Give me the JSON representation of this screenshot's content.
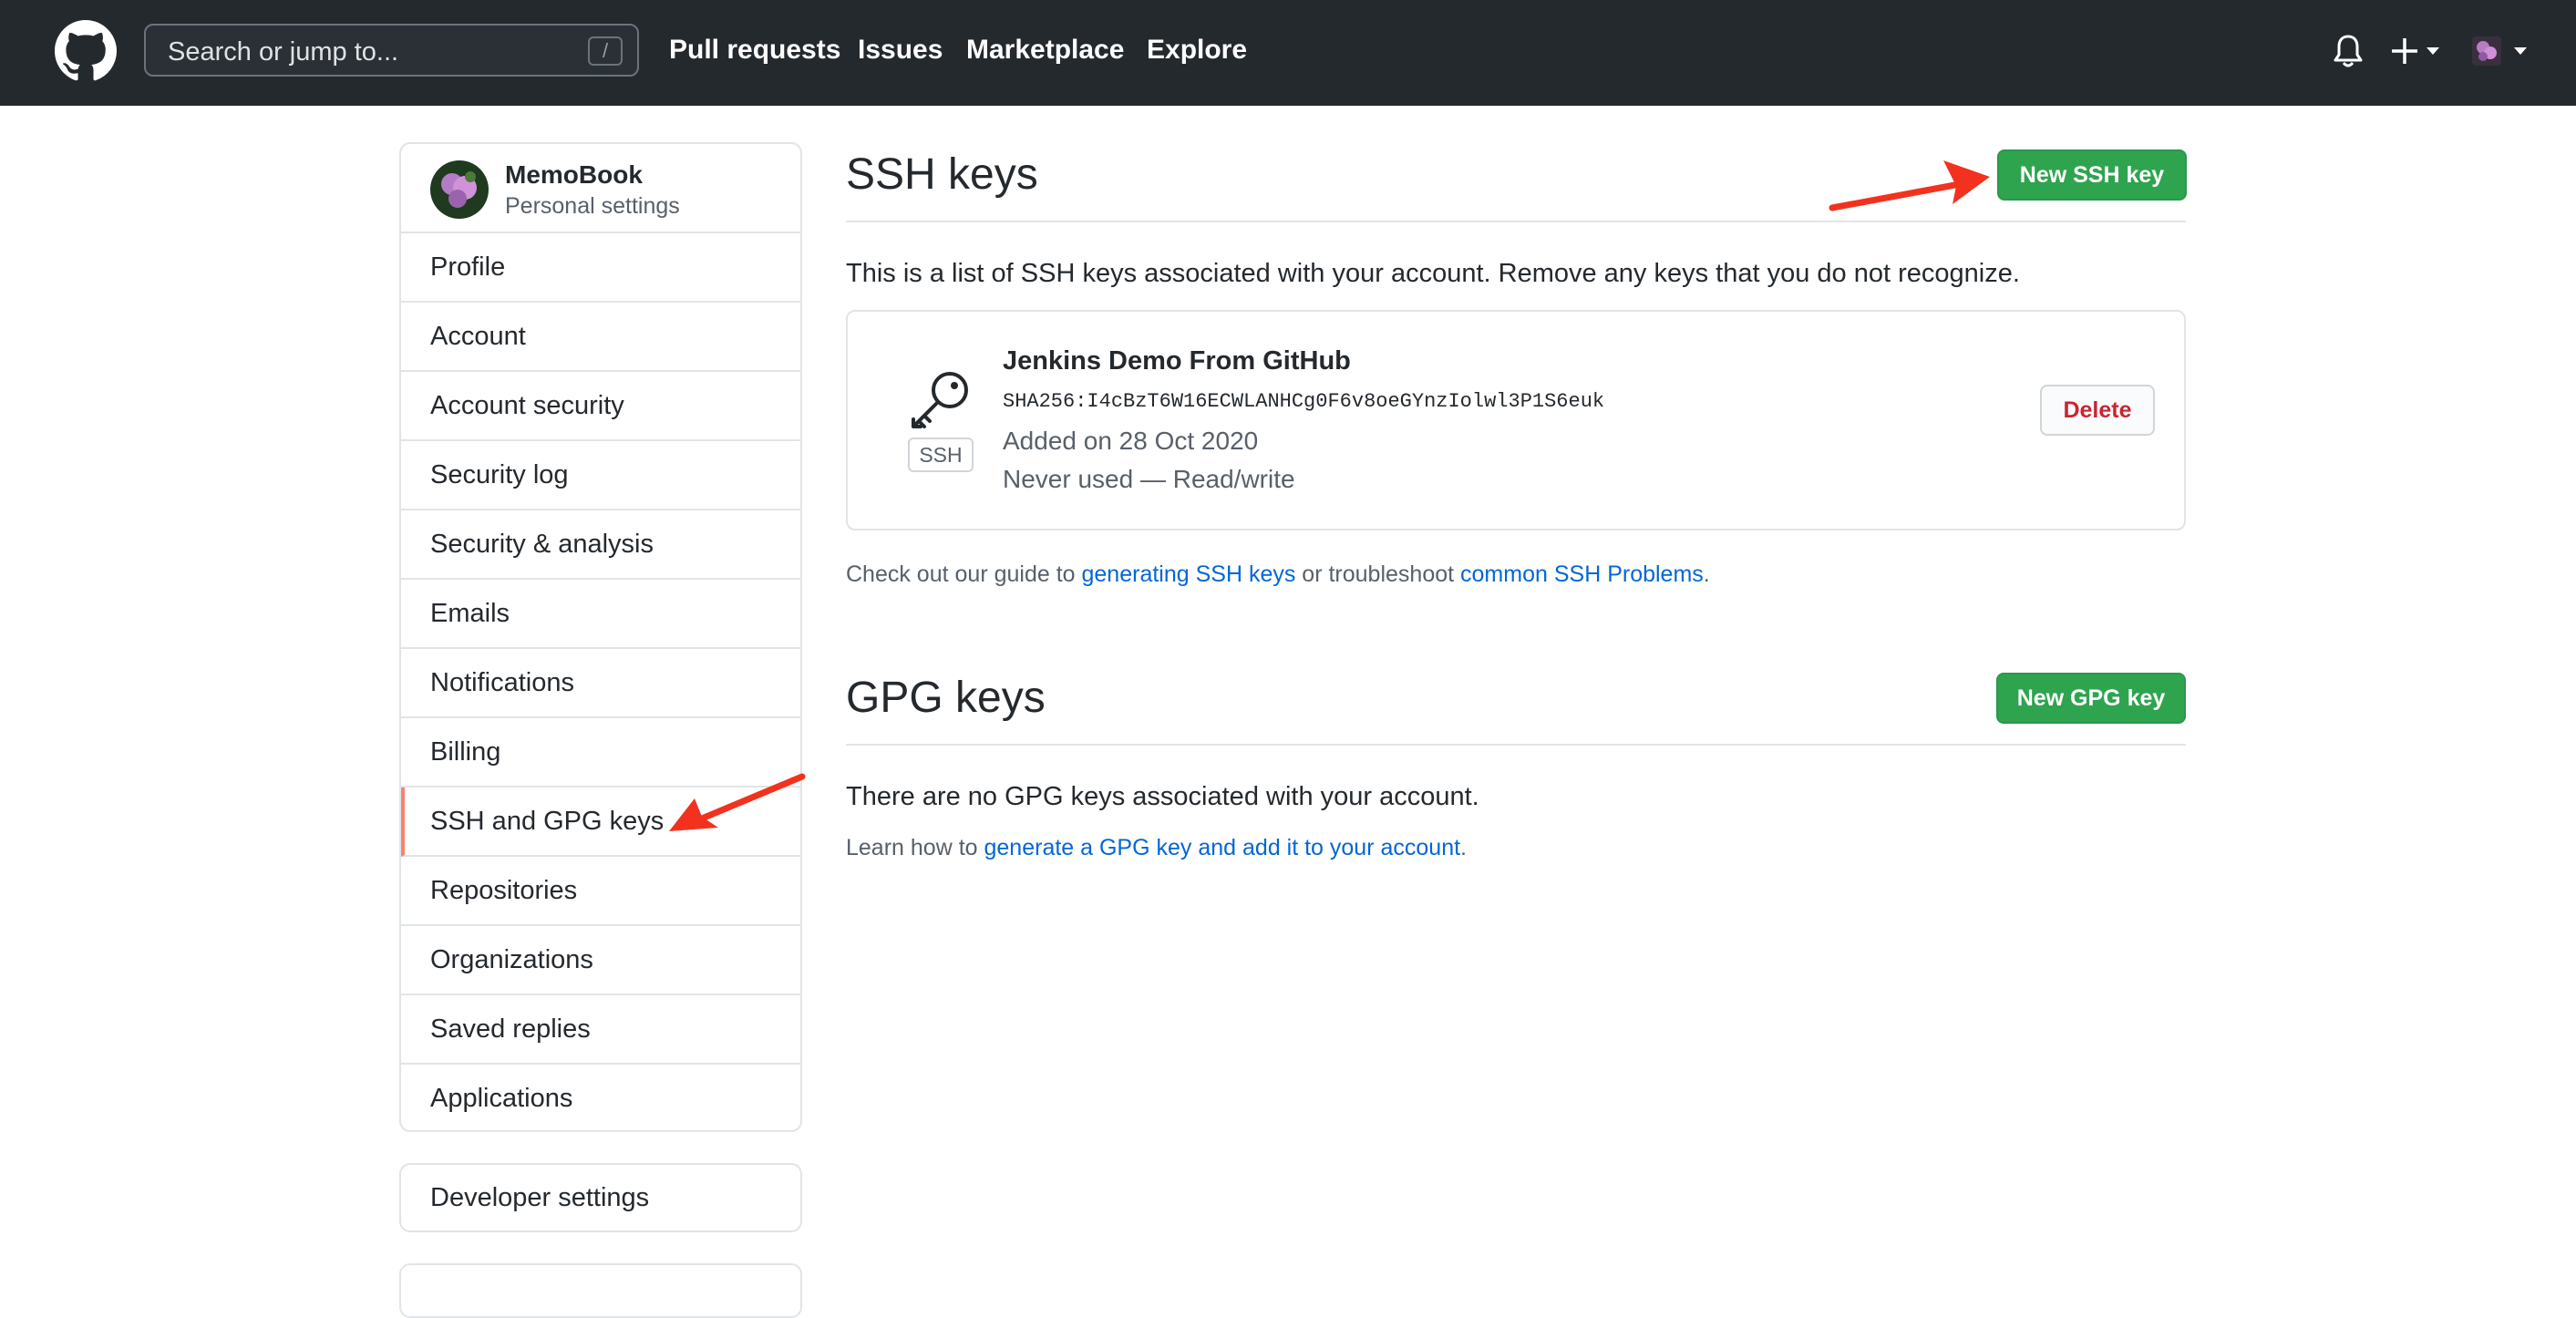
{
  "header": {
    "search_placeholder": "Search or jump to...",
    "search_shortcut": "/",
    "nav": [
      "Pull requests",
      "Issues",
      "Marketplace",
      "Explore"
    ]
  },
  "sidebar": {
    "user_name": "MemoBook",
    "user_subtitle": "Personal settings",
    "items": [
      "Profile",
      "Account",
      "Account security",
      "Security log",
      "Security & analysis",
      "Emails",
      "Notifications",
      "Billing",
      "SSH and GPG keys",
      "Repositories",
      "Organizations",
      "Saved replies",
      "Applications"
    ],
    "active_item": "SSH and GPG keys",
    "developer_settings": "Developer settings"
  },
  "ssh": {
    "title": "SSH keys",
    "new_button": "New SSH key",
    "description": "This is a list of SSH keys associated with your account. Remove any keys that you do not recognize.",
    "key": {
      "badge": "SSH",
      "title": "Jenkins Demo From GitHub",
      "fingerprint": "SHA256:I4cBzT6W16ECWLANHCg0F6v8oeGYnzIolwl3P1S6euk",
      "added": "Added on 28 Oct 2020",
      "usage": "Never used — Read/write",
      "delete_button": "Delete"
    },
    "help_prefix": "Check out our guide to ",
    "help_link1": "generating SSH keys",
    "help_middle": " or troubleshoot ",
    "help_link2": "common SSH Problems",
    "help_suffix": "."
  },
  "gpg": {
    "title": "GPG keys",
    "new_button": "New GPG key",
    "empty_text": "There are no GPG keys associated with your account.",
    "help_prefix": "Learn how to ",
    "help_link": "generate a GPG key and add it to your account",
    "help_suffix": "."
  },
  "colors": {
    "header_bg": "#24292e",
    "green_button": "#2ea44f",
    "link": "#0366d6",
    "active_marker": "#f9826c",
    "delete_text": "#cb2431",
    "annotation_arrow": "#f2321e"
  }
}
